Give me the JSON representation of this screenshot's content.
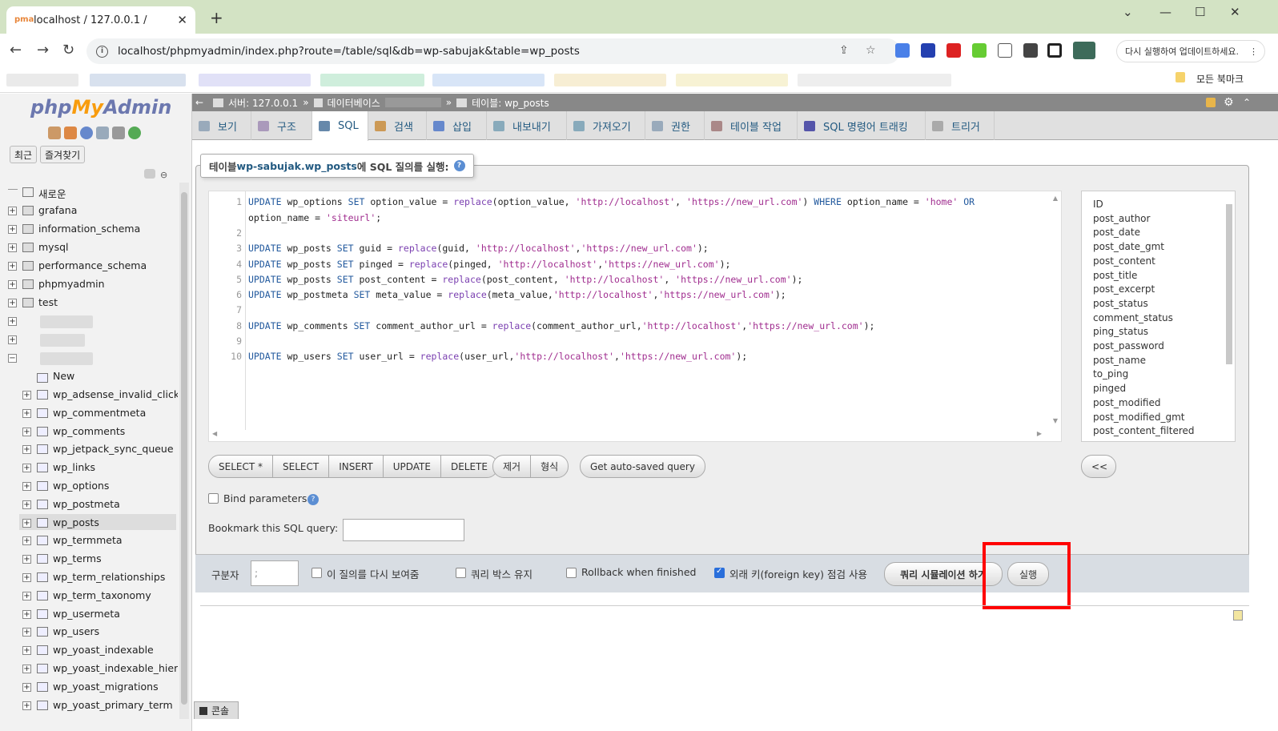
{
  "browser": {
    "tab_title": "localhost / 127.0.0.1 /",
    "url": "localhost/phpmyadmin/index.php?route=/table/sql&db=wp-sabujak&table=wp_posts",
    "update_label": "다시 실행하여 업데이트하세요.",
    "all_bookmarks": "모든 북마크"
  },
  "nav": {
    "logo_php": "php",
    "logo_my": "My",
    "logo_admin": "Admin",
    "recent": "최근",
    "favorites": "즐겨찾기",
    "new_db": "새로운",
    "databases": [
      "grafana",
      "information_schema",
      "mysql",
      "performance_schema",
      "phpmyadmin",
      "test"
    ],
    "new_table": "New",
    "tables": [
      "wp_adsense_invalid_click_p",
      "wp_commentmeta",
      "wp_comments",
      "wp_jetpack_sync_queue",
      "wp_links",
      "wp_options",
      "wp_postmeta",
      "wp_posts",
      "wp_termmeta",
      "wp_terms",
      "wp_term_relationships",
      "wp_term_taxonomy",
      "wp_usermeta",
      "wp_users",
      "wp_yoast_indexable",
      "wp_yoast_indexable_hierar",
      "wp_yoast_migrations",
      "wp_yoast_primary_term"
    ]
  },
  "breadcrumb": {
    "server": "서버: 127.0.0.1",
    "sep": "»",
    "database": "데이터베이스",
    "sep2": "»",
    "table": "테이블: wp_posts"
  },
  "tabs": [
    "보기",
    "구조",
    "SQL",
    "검색",
    "삽입",
    "내보내기",
    "가져오기",
    "권한",
    "테이블 작업",
    "SQL 명령어 트래킹",
    "트리거"
  ],
  "legend_prefix": "테이블 ",
  "legend_table": "wp-sabujak.wp_posts",
  "legend_suffix": "에 SQL 질의를 실행:",
  "editor": {
    "line_numbers": [
      "1",
      "2",
      "3",
      "4",
      "5",
      "6",
      "7",
      "8",
      "9",
      "10"
    ],
    "lines": [
      "UPDATE wp_options SET option_value = replace(option_value, 'http://localhost', 'https://new_url.com') WHERE option_name = 'home' OR",
      "option_name = 'siteurl';",
      "",
      "UPDATE wp_posts SET guid = replace(guid, 'http://localhost','https://new_url.com');",
      "UPDATE wp_posts SET pinged = replace(pinged, 'http://localhost','https://new_url.com');",
      "UPDATE wp_posts SET post_content = replace(post_content, 'http://localhost', 'https://new_url.com');",
      "UPDATE wp_postmeta SET meta_value = replace(meta_value,'http://localhost','https://new_url.com');",
      "",
      "UPDATE wp_comments SET comment_author_url = replace(comment_author_url,'http://localhost','https://new_url.com');",
      "",
      "UPDATE wp_users SET user_url = replace(user_url,'http://localhost','https://new_url.com');"
    ]
  },
  "columns": [
    "ID",
    "post_author",
    "post_date",
    "post_date_gmt",
    "post_content",
    "post_title",
    "post_excerpt",
    "post_status",
    "comment_status",
    "ping_status",
    "post_password",
    "post_name",
    "to_ping",
    "pinged",
    "post_modified",
    "post_modified_gmt",
    "post_content_filtered"
  ],
  "sql_buttons": [
    "SELECT *",
    "SELECT",
    "INSERT",
    "UPDATE",
    "DELETE"
  ],
  "edit_buttons": [
    "제거",
    "형식"
  ],
  "autosave_label": "Get auto-saved query",
  "insert_label": "<<",
  "bind_params": "Bind parameters",
  "bookmark_label": "Bookmark this SQL query:",
  "bottom": {
    "delimiter_label": "구분자",
    "delimiter_value": ";",
    "show_again": "이 질의를 다시 보여줌",
    "retain_box": "쿼리 박스 유지",
    "rollback": "Rollback when finished",
    "foreign_key": "외래 키(foreign key) 점검 사용",
    "simulate": "쿼리 시뮬레이션 하기",
    "go": "실행"
  },
  "console_label": "콘솔"
}
